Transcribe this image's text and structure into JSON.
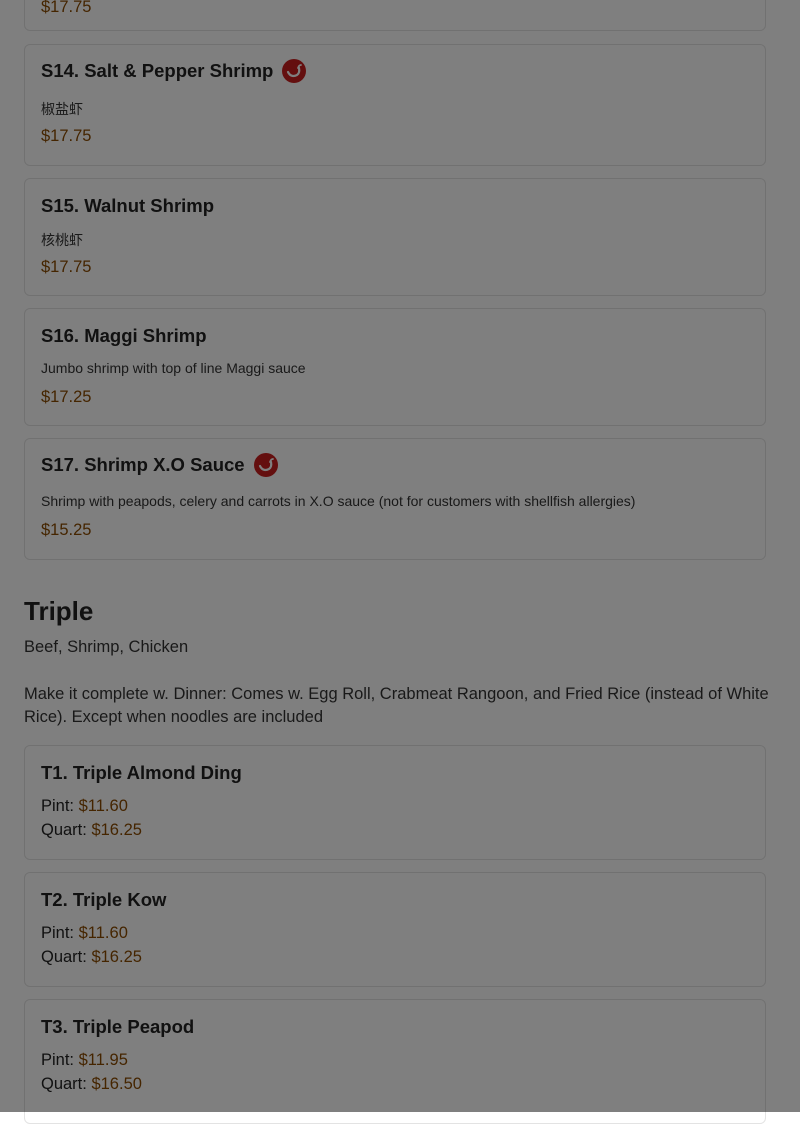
{
  "colors": {
    "price": "#8a4a00",
    "spicy_icon": "#c81e1e",
    "overlay": "rgba(0,0,0,0.5)"
  },
  "partial_item": {
    "price": "$17.75"
  },
  "items": [
    {
      "name": "S14. Salt & Pepper Shrimp",
      "icon": "spicy-pepper-icon",
      "description": "椒盐虾",
      "price": "$17.75"
    },
    {
      "name": "S15. Walnut Shrimp",
      "description": "核桃虾",
      "price": "$17.75"
    },
    {
      "name": "S16. Maggi Shrimp",
      "description": "Jumbo shrimp with top of line Maggi sauce",
      "price": "$17.25"
    },
    {
      "name": "S17. Shrimp X.O Sauce",
      "icon": "spicy-pepper-icon",
      "description": "Shrimp with peapods, celery and carrots in X.O sauce (not for customers with shellfish allergies)",
      "price": "$15.25"
    }
  ],
  "section": {
    "title": "Triple",
    "subtitle": "Beef, Shrimp, Chicken",
    "note": "Make it complete w. Dinner: Comes w. Egg Roll, Crabmeat Rangoon, and Fried Rice (instead of White Rice). Except when noodles are included"
  },
  "triple_items": [
    {
      "name": "T1. Triple Almond Ding",
      "pint_label": "Pint:",
      "pint_price": "$11.60",
      "quart_label": "Quart:",
      "quart_price": "$16.25"
    },
    {
      "name": "T2. Triple Kow",
      "pint_label": "Pint:",
      "pint_price": "$11.60",
      "quart_label": "Quart:",
      "quart_price": "$16.25"
    },
    {
      "name": "T3. Triple Peapod",
      "pint_label": "Pint:",
      "pint_price": "$11.95",
      "quart_label": "Quart:",
      "quart_price": "$16.50"
    }
  ]
}
